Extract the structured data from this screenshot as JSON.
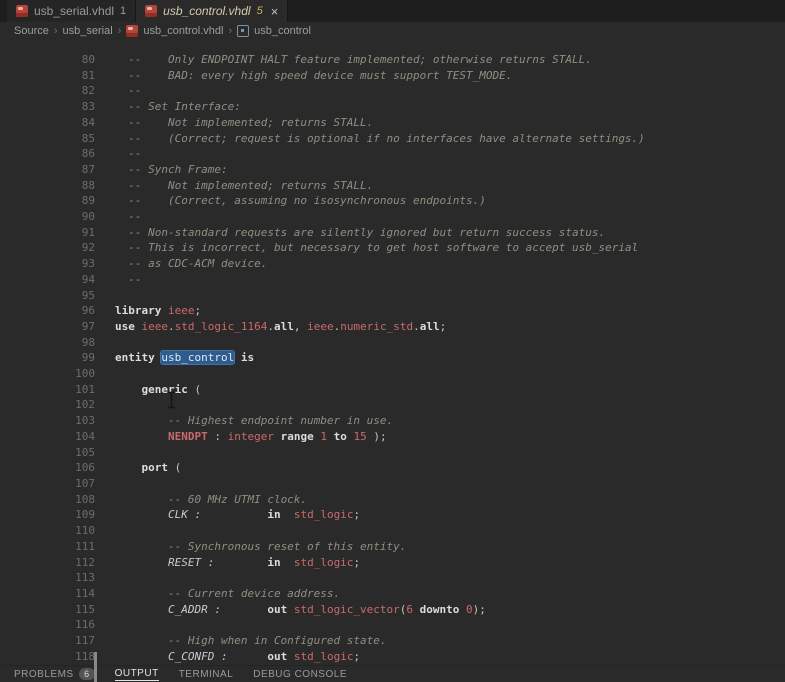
{
  "tabs": [
    {
      "label": "usb_serial.vhdl",
      "badge": "1"
    },
    {
      "label": "usb_control.vhdl",
      "badge": "5",
      "close": "×"
    }
  ],
  "breadcrumbs": {
    "separator": "›",
    "items": [
      "Source",
      "usb_serial",
      "usb_control.vhdl",
      "usb_control"
    ]
  },
  "panel": {
    "tabs": [
      {
        "label": "PROBLEMS",
        "badge": "6"
      },
      {
        "label": "OUTPUT"
      },
      {
        "label": "TERMINAL"
      },
      {
        "label": "DEBUG CONSOLE"
      }
    ]
  },
  "colors": {
    "editor_background": "#2a2a2a",
    "tabbar_background": "#1e1e1e",
    "comment": "#8f8f82",
    "keyword": "#dcdcdc",
    "type": "#c96a6a",
    "selection": "#2e5c8f"
  },
  "editor": {
    "lines": [
      {
        "n": 80,
        "t": [
          [
            "  --    Only ENDPOINT HALT feature implemented; otherwise returns STALL.",
            "cm"
          ]
        ]
      },
      {
        "n": 81,
        "t": [
          [
            "  --    BAD: every high speed device must support TEST_MODE.",
            "cm"
          ]
        ]
      },
      {
        "n": 82,
        "t": [
          [
            "  --",
            "cm"
          ]
        ]
      },
      {
        "n": 83,
        "t": [
          [
            "  -- Set Interface:",
            "cm"
          ]
        ]
      },
      {
        "n": 84,
        "t": [
          [
            "  --    Not implemented; returns STALL.",
            "cm"
          ]
        ]
      },
      {
        "n": 85,
        "t": [
          [
            "  --    (Correct; request is optional if no interfaces have alternate settings.)",
            "cm"
          ]
        ]
      },
      {
        "n": 86,
        "t": [
          [
            "  --",
            "cm"
          ]
        ]
      },
      {
        "n": 87,
        "t": [
          [
            "  -- Synch Frame:",
            "cm"
          ]
        ]
      },
      {
        "n": 88,
        "t": [
          [
            "  --    Not implemented; returns STALL.",
            "cm"
          ]
        ]
      },
      {
        "n": 89,
        "t": [
          [
            "  --    (Correct, assuming no isosynchronous endpoints.)",
            "cm"
          ]
        ]
      },
      {
        "n": 90,
        "t": [
          [
            "  --",
            "cm"
          ]
        ]
      },
      {
        "n": 91,
        "t": [
          [
            "  -- Non-standard requests are silently ignored but return success status.",
            "cm"
          ]
        ]
      },
      {
        "n": 92,
        "t": [
          [
            "  -- This is incorrect, but necessary to get host software to accept usb_serial",
            "cm"
          ]
        ]
      },
      {
        "n": 93,
        "t": [
          [
            "  -- as CDC-ACM device.",
            "cm"
          ]
        ]
      },
      {
        "n": 94,
        "t": [
          [
            "  --",
            "cm"
          ]
        ]
      },
      {
        "n": 95,
        "t": []
      },
      {
        "n": 96,
        "t": [
          [
            "library",
            "kw"
          ],
          [
            " ",
            "pl"
          ],
          [
            "ieee",
            "id"
          ],
          [
            ";",
            "pl"
          ]
        ]
      },
      {
        "n": 97,
        "t": [
          [
            "use",
            "kw"
          ],
          [
            " ",
            "pl"
          ],
          [
            "ieee",
            "id"
          ],
          [
            ".",
            "pl"
          ],
          [
            "std_logic_1164",
            "id"
          ],
          [
            ".",
            "pl"
          ],
          [
            "all",
            "kw"
          ],
          [
            ", ",
            "pl"
          ],
          [
            "ieee",
            "id"
          ],
          [
            ".",
            "pl"
          ],
          [
            "numeric_std",
            "id"
          ],
          [
            ".",
            "pl"
          ],
          [
            "all",
            "kw"
          ],
          [
            ";",
            "pl"
          ]
        ]
      },
      {
        "n": 98,
        "t": []
      },
      {
        "n": 99,
        "t": [
          [
            "entity",
            "kw"
          ],
          [
            " ",
            "pl"
          ],
          [
            "usb_control",
            "sel"
          ],
          [
            " ",
            "pl"
          ],
          [
            "is",
            "kw"
          ]
        ]
      },
      {
        "n": 100,
        "t": []
      },
      {
        "n": 101,
        "t": [
          [
            "    ",
            "pl"
          ],
          [
            "generic",
            "kw"
          ],
          [
            " (",
            "pl"
          ]
        ]
      },
      {
        "n": 102,
        "t": []
      },
      {
        "n": 103,
        "t": [
          [
            "        -- Highest endpoint number in use.",
            "cm"
          ]
        ]
      },
      {
        "n": 104,
        "t": [
          [
            "        ",
            "pl"
          ],
          [
            "NENDPT",
            "idb"
          ],
          [
            " : ",
            "pl"
          ],
          [
            "integer",
            "id"
          ],
          [
            " ",
            "pl"
          ],
          [
            "range",
            "kw"
          ],
          [
            " ",
            "pl"
          ],
          [
            "1",
            "id"
          ],
          [
            " ",
            "pl"
          ],
          [
            "to",
            "kw"
          ],
          [
            " ",
            "pl"
          ],
          [
            "15",
            "id"
          ],
          [
            " );",
            "pl"
          ]
        ]
      },
      {
        "n": 105,
        "t": []
      },
      {
        "n": 106,
        "t": [
          [
            "    ",
            "pl"
          ],
          [
            "port",
            "kw"
          ],
          [
            " (",
            "pl"
          ]
        ]
      },
      {
        "n": 107,
        "t": []
      },
      {
        "n": 108,
        "t": [
          [
            "        -- 60 MHz UTMI clock.",
            "cm"
          ]
        ]
      },
      {
        "n": 109,
        "t": [
          [
            "        ",
            "pl"
          ],
          [
            "CLK :",
            "it"
          ],
          [
            "          ",
            "pl"
          ],
          [
            "in",
            "kw"
          ],
          [
            "  ",
            "pl"
          ],
          [
            "std_logic",
            "id"
          ],
          [
            ";",
            "pl"
          ]
        ]
      },
      {
        "n": 110,
        "t": []
      },
      {
        "n": 111,
        "t": [
          [
            "        -- Synchronous reset of this entity.",
            "cm"
          ]
        ]
      },
      {
        "n": 112,
        "t": [
          [
            "        ",
            "pl"
          ],
          [
            "RESET :",
            "it"
          ],
          [
            "        ",
            "pl"
          ],
          [
            "in",
            "kw"
          ],
          [
            "  ",
            "pl"
          ],
          [
            "std_logic",
            "id"
          ],
          [
            ";",
            "pl"
          ]
        ]
      },
      {
        "n": 113,
        "t": []
      },
      {
        "n": 114,
        "t": [
          [
            "        -- Current device address.",
            "cm"
          ]
        ]
      },
      {
        "n": 115,
        "t": [
          [
            "        ",
            "pl"
          ],
          [
            "C_ADDR :",
            "it"
          ],
          [
            "       ",
            "pl"
          ],
          [
            "out",
            "kw"
          ],
          [
            " ",
            "pl"
          ],
          [
            "std_logic_vector",
            "id"
          ],
          [
            "(",
            "pl"
          ],
          [
            "6",
            "id"
          ],
          [
            " ",
            "pl"
          ],
          [
            "downto",
            "kw"
          ],
          [
            " ",
            "pl"
          ],
          [
            "0",
            "id"
          ],
          [
            ");",
            "pl"
          ]
        ]
      },
      {
        "n": 116,
        "t": []
      },
      {
        "n": 117,
        "t": [
          [
            "        -- High when in Configured state.",
            "cm"
          ]
        ]
      },
      {
        "n": 118,
        "t": [
          [
            "        ",
            "pl"
          ],
          [
            "C_CONFD :",
            "it"
          ],
          [
            "      ",
            "pl"
          ],
          [
            "out",
            "kw"
          ],
          [
            " ",
            "pl"
          ],
          [
            "std_logic",
            "id"
          ],
          [
            ";",
            "pl"
          ]
        ]
      }
    ]
  }
}
